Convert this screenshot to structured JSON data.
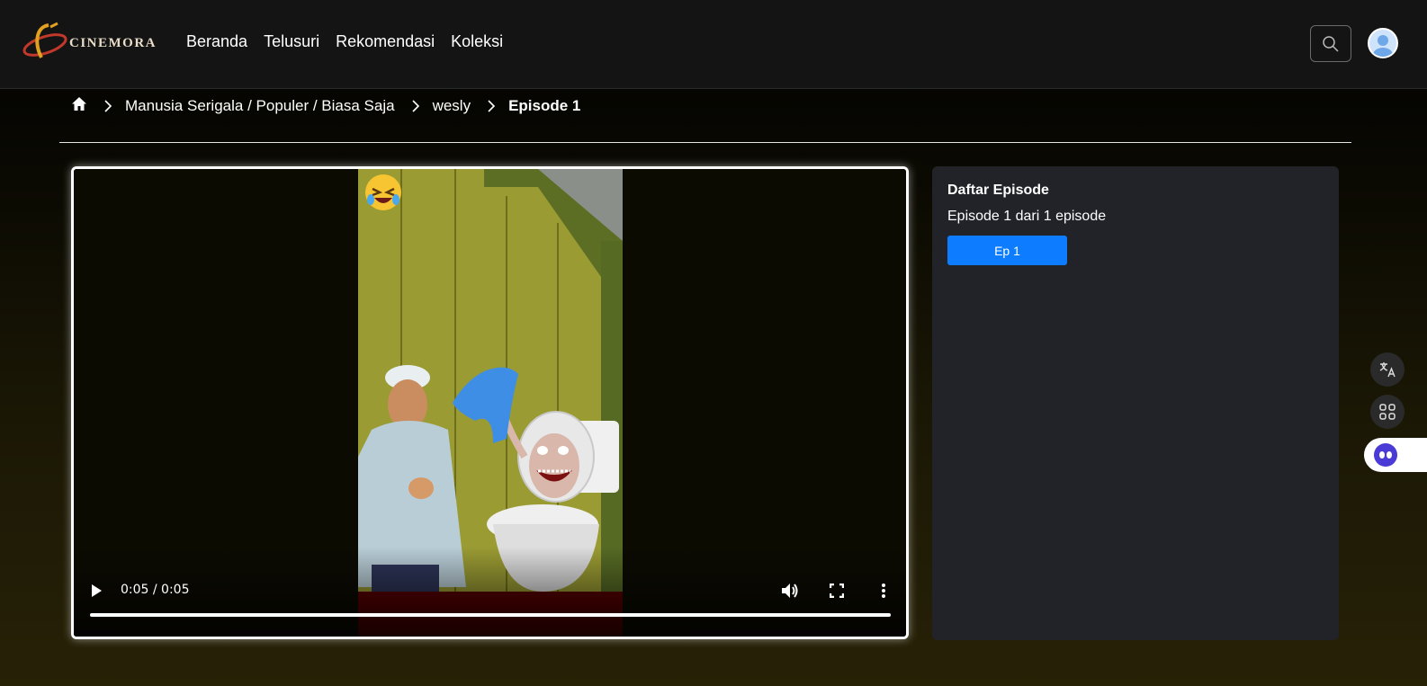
{
  "brand": {
    "name": "CINEMORA"
  },
  "nav": {
    "items": [
      "Beranda",
      "Telusuri",
      "Rekomendasi",
      "Koleksi"
    ]
  },
  "breadcrumb": {
    "category": "Manusia Serigala / Populer / Biasa Saja",
    "user": "wesly",
    "current": "Episode 1"
  },
  "player": {
    "time": "0:05 / 0:05",
    "progress": 1.0
  },
  "episodes": {
    "title": "Daftar Episode",
    "subtitle": "Episode 1 dari 1 episode",
    "buttons": [
      "Ep 1"
    ]
  },
  "colors": {
    "accent": "#0d7cff",
    "panel": "#212329",
    "header": "#141414"
  },
  "icons": [
    "home-icon",
    "chevron-right-icon",
    "search-icon",
    "avatar",
    "play-icon",
    "volume-icon",
    "fullscreen-icon",
    "more-vertical-icon",
    "translate-icon",
    "apps-icon",
    "assistant-icon",
    "laughing-emoji"
  ]
}
